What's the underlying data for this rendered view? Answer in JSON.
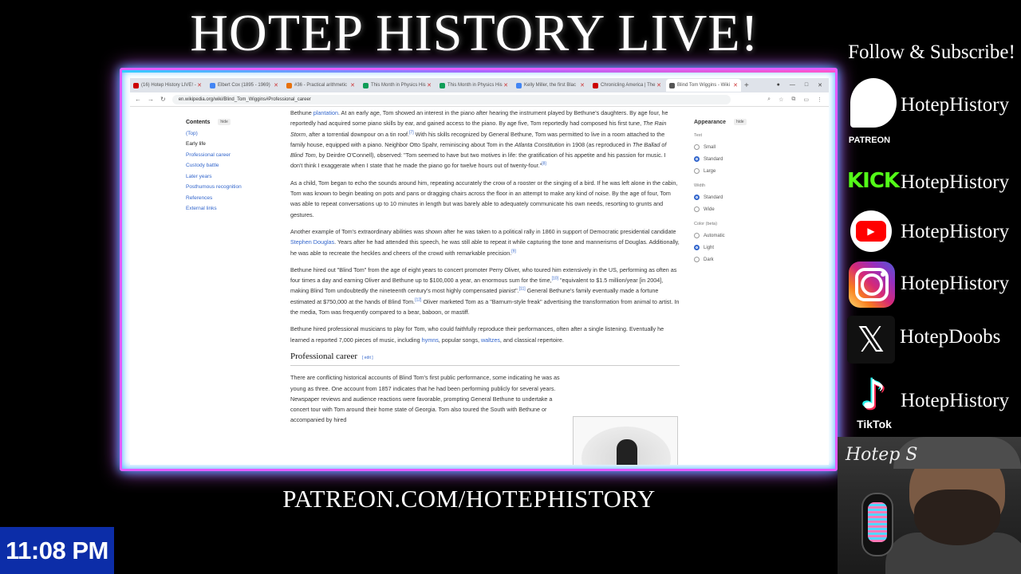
{
  "stream": {
    "title": "HOTEP HISTORY LIVE!",
    "patreon_url": "PATREON.COM/HOTEPHISTORY",
    "clock": "11:08 PM",
    "webcam_signature": "Hotep S"
  },
  "social": {
    "heading": "Follow & Subscribe!",
    "patreon": {
      "label": "PATREON",
      "handle": "HotepHistory"
    },
    "kick": {
      "logo_text": "KICK",
      "handle": "HotepHistory"
    },
    "youtube": {
      "handle": "HotepHistory"
    },
    "instagram": {
      "handle": "HotepHistory"
    },
    "x": {
      "handle": "HotepDoobs"
    },
    "tiktok": {
      "label": "TikTok",
      "handle": "HotepHistory"
    }
  },
  "browser": {
    "tabs": [
      {
        "label": "(16) Hotep History LIVE! -",
        "color": "#c00"
      },
      {
        "label": "Elbert Cox (1895 - 1969)",
        "color": "#4285f4"
      },
      {
        "label": "#36 - Practical arithmetic",
        "color": "#e8710a"
      },
      {
        "label": "This Month in Physics His",
        "color": "#0f9d58"
      },
      {
        "label": "This Month in Physics His",
        "color": "#0f9d58"
      },
      {
        "label": "Kelly Miller, the first Blac",
        "color": "#4285f4"
      },
      {
        "label": "Chronicling America | The",
        "color": "#c00"
      },
      {
        "label": "Blind Tom Wiggins - Wiki",
        "color": "#555"
      }
    ],
    "url": "en.wikipedia.org/wiki/Blind_Tom_Wiggins#Professional_career"
  },
  "toc": {
    "title": "Contents",
    "hide": "hide",
    "items": [
      "(Top)",
      "Early life",
      "Professional career",
      "Custody battle",
      "Later years",
      "Posthumous recognition",
      "References",
      "External links"
    ]
  },
  "article": {
    "p1_link": "plantation",
    "p1_pre": "Bethune ",
    "p1_a": ". At an early age, Tom showed an interest in the piano after hearing the instrument played by Bethune's daughters. By age four, he reportedly had acquired some piano skills by ear, and gained access to the piano. By age five, Tom reportedly had composed his first tune, ",
    "p1_i1": "The Rain Storm",
    "p1_b": ", after a torrential downpour on a tin roof.",
    "p1_c1": "[7]",
    "p1_c": " With his skills recognized by General Bethune, Tom was permitted to live in a room attached to the family house, equipped with a piano. Neighbor Otto Spahr, reminiscing about Tom in the ",
    "p1_i2": "Atlanta Constitution",
    "p1_d": " in 1908 (as reproduced in ",
    "p1_i3": "The Ballad of Blind Tom",
    "p1_e": ", by Deirdre O'Connell), observed: \"Tom seemed to have but two motives in life: the gratification of his appetite and his passion for music. I don't think I exaggerate when I state that he made the piano go for twelve hours out of twenty-four.\"",
    "p1_c2": "[8]",
    "p2": "As a child, Tom began to echo the sounds around him, repeating accurately the crow of a rooster or the singing of a bird. If he was left alone in the cabin, Tom was known to begin beating on pots and pans or dragging chairs across the floor in an attempt to make any kind of noise. By the age of four, Tom was able to repeat conversations up to 10 minutes in length but was barely able to adequately communicate his own needs, resorting to grunts and gestures.",
    "p3_a": "Another example of Tom's extraordinary abilities was shown after he was taken to a political rally in 1860 in support of Democratic presidential candidate ",
    "p3_link": "Stephen Douglas",
    "p3_b": ". Years after he had attended this speech, he was still able to repeat it while capturing the tone and mannerisms of Douglas. Additionally, he was able to recreate the heckles and cheers of the crowd with remarkable precision.",
    "p3_c": "[9]",
    "p4_a": "Bethune hired out \"Blind Tom\" from the age of eight years to concert promoter Perry Oliver, who toured him extensively in the US, performing as often as four times a day and earning Oliver and Bethune up to $100,000 a year, an enormous sum for the time,",
    "p4_c1": "[10]",
    "p4_b": " \"equivalent to $1.5 million/year [in 2004], making Blind Tom undoubtedly the nineteenth century's most highly compensated pianist\".",
    "p4_c2": "[11]",
    "p4_c": " General Bethune's family eventually made a fortune estimated at $750,000 at the hands of Blind Tom.",
    "p4_c3": "[12]",
    "p4_d": " Oliver marketed Tom as a \"Barnum-style freak\" advertising the transformation from animal to artist. In the media, Tom was frequently compared to a bear, baboon, or mastiff.",
    "p5_a": "Bethune hired professional musicians to play for Tom, who could faithfully reproduce their performances, often after a single listening. Eventually he learned a reported 7,000 pieces of music, including ",
    "p5_l1": "hymns",
    "p5_b": ", popular songs, ",
    "p5_l2": "waltzes",
    "p5_c": ", and classical repertoire.",
    "h2": "Professional career",
    "h2_edit": "[ edit ]",
    "p6": "There are conflicting historical accounts of Blind Tom's first public performance, some indicating he was as young as three. One account from 1857 indicates that he had been performing publicly for several years. Newspaper reviews and audience reactions were favorable, prompting General Bethune to undertake a concert tour with Tom around their home state of Georgia. Tom also toured the South with Bethune or accompanied by hired"
  },
  "appearance": {
    "title": "Appearance",
    "hide": "hide",
    "text_label": "Text",
    "text_options": [
      "Small",
      "Standard",
      "Large"
    ],
    "text_selected": "Standard",
    "width_label": "Width",
    "width_options": [
      "Standard",
      "Wide"
    ],
    "width_selected": "Standard",
    "color_label": "Color (beta)",
    "color_options": [
      "Automatic",
      "Light",
      "Dark"
    ],
    "color_selected": "Light"
  }
}
